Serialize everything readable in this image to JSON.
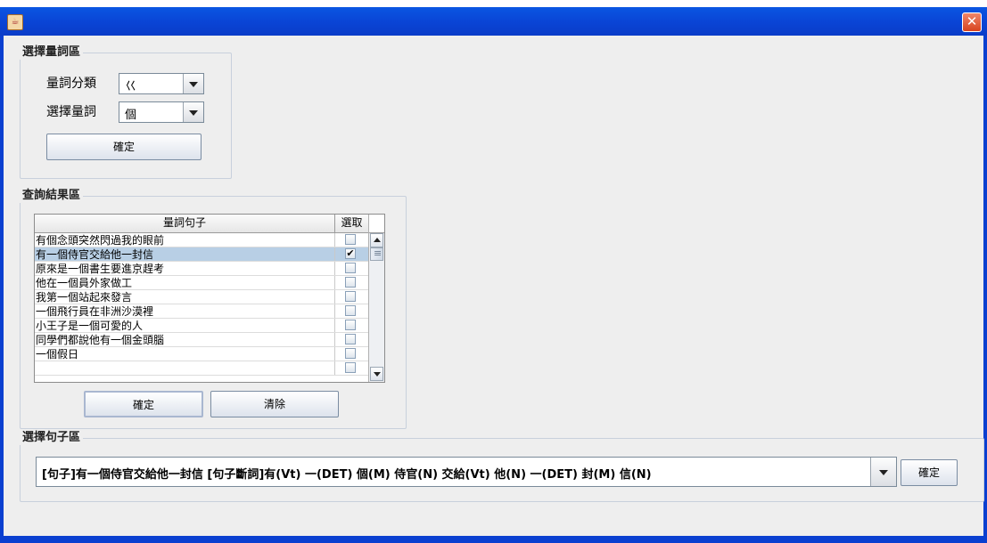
{
  "window": {
    "title": "",
    "close_glyph": "✕",
    "app_icon": "java-cup-icon"
  },
  "classifier_group": {
    "title": "選擇量詞區",
    "category_label": "量詞分類",
    "category_value": "巜",
    "classifier_label": "選擇量詞",
    "classifier_value": "個",
    "confirm_label": "確定"
  },
  "results_group": {
    "title": "查詢結果區",
    "columns": [
      "量詞句子",
      "選取"
    ],
    "rows": [
      {
        "text": "有個念頭突然閃過我的眼前",
        "checked": false
      },
      {
        "text": "有一個侍官交給他一封信",
        "checked": true
      },
      {
        "text": "原來是一個書生要進京趕考",
        "checked": false
      },
      {
        "text": "他在一個員外家做工",
        "checked": false
      },
      {
        "text": "我第一個站起來發言",
        "checked": false
      },
      {
        "text": "一個飛行員在非洲沙漠裡",
        "checked": false
      },
      {
        "text": "小王子是一個可愛的人",
        "checked": false
      },
      {
        "text": "同學們都說他有一個金頭腦",
        "checked": false
      },
      {
        "text": "一個假日",
        "checked": false
      },
      {
        "text": "",
        "checked": false
      }
    ],
    "confirm_label": "確定",
    "clear_label": "清除"
  },
  "sentence_group": {
    "title": "選擇句子區",
    "selected_sentence": "[句子]有一個侍官交給他一封信 [句子斷詞]有(Vt) 一(DET) 個(M) 侍官(N) 交給(Vt) 他(N) 一(DET) 封(M) 信(N)",
    "confirm_label": "確定"
  },
  "colors": {
    "titlebar": "#0a45d6",
    "selected_row": "#b8cfe5",
    "close_button": "#d8431e"
  }
}
